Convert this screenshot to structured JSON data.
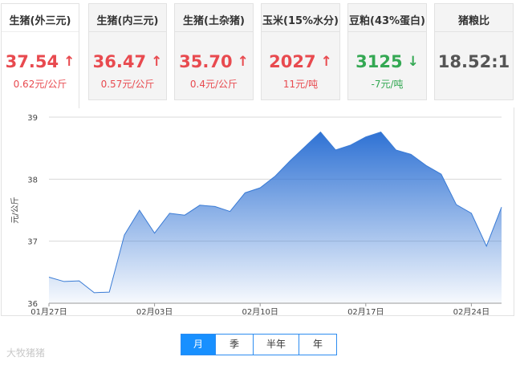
{
  "cards": [
    {
      "name": "生猪(外三元)",
      "price": "37.54",
      "change": "0.62元/公斤",
      "trend": "up"
    },
    {
      "name": "生猪(内三元)",
      "price": "36.47",
      "change": "0.57元/公斤",
      "trend": "up"
    },
    {
      "name": "生猪(土杂猪)",
      "price": "35.70",
      "change": "0.4元/公斤",
      "trend": "up"
    },
    {
      "name": "玉米(15%水分)",
      "price": "2027",
      "change": "11元/吨",
      "trend": "up"
    },
    {
      "name": "豆粕(43%蛋白)",
      "price": "3125",
      "change": "-7元/吨",
      "trend": "down"
    },
    {
      "name": "猪粮比",
      "price": "18.52:1",
      "change": "",
      "trend": "none"
    }
  ],
  "colors": {
    "up": "#e84a4f",
    "down": "#34a853",
    "accent": "#1890ff",
    "line": "#3a7bd5"
  },
  "icons": {
    "up": "arrow-up-icon",
    "down": "arrow-down-icon"
  },
  "ranges": [
    "月",
    "季",
    "半年",
    "年"
  ],
  "selected_range": "月",
  "watermark": "大牧猪猪",
  "chart_data": {
    "type": "area",
    "ylabel": "元/公斤",
    "ylim": [
      36,
      39
    ],
    "yticks": [
      "36",
      "37",
      "38",
      "39"
    ],
    "xticks": [
      {
        "label": "01月27日",
        "index": 0
      },
      {
        "label": "02月03日",
        "index": 7
      },
      {
        "label": "02月10日",
        "index": 14
      },
      {
        "label": "02月17日",
        "index": 21
      },
      {
        "label": "02月24日",
        "index": 28
      }
    ],
    "grid": true,
    "series": [
      {
        "values": [
          36.42,
          36.35,
          36.36,
          36.17,
          36.18,
          37.1,
          37.5,
          37.13,
          37.45,
          37.42,
          37.58,
          37.56,
          37.48,
          37.78,
          37.86,
          38.05,
          38.3,
          38.53,
          38.76,
          38.47,
          38.55,
          38.68,
          38.76,
          38.47,
          38.4,
          38.22,
          38.08,
          37.59,
          37.45,
          36.92,
          37.55
        ]
      }
    ]
  }
}
